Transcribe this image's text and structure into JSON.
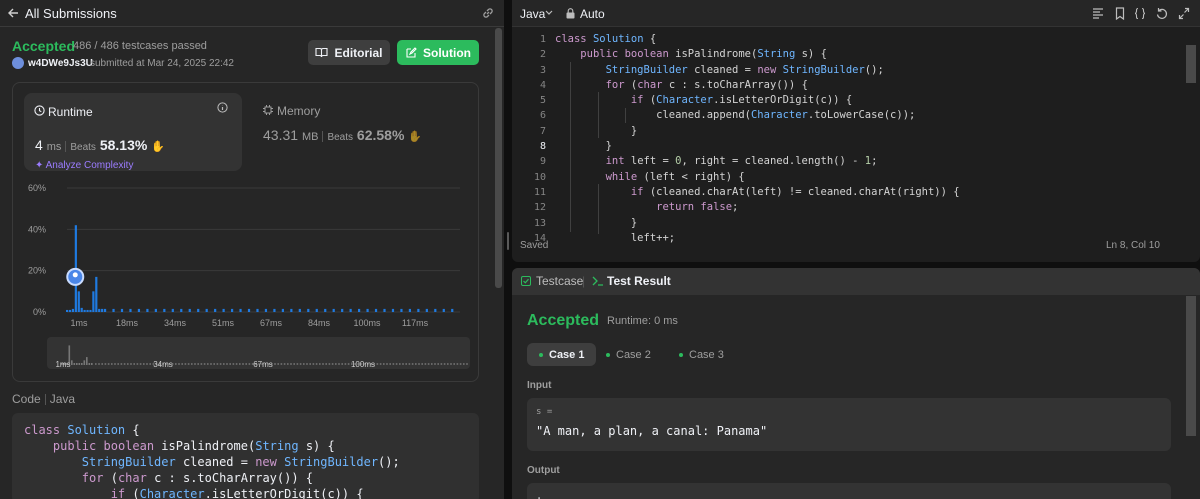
{
  "left_header": {
    "title": "All Submissions"
  },
  "submission": {
    "status": "Accepted",
    "testcases": "486 / 486 testcases passed",
    "username": "w4DWe9Js3U",
    "submitted_at": "submitted at Mar 24, 2025 22:42",
    "editorial_label": "Editorial",
    "solution_label": "Solution"
  },
  "runtime": {
    "label": "Runtime",
    "value": "4",
    "unit": "ms",
    "beats_label": "Beats",
    "beats_value": "58.13%",
    "analyze_label": "Analyze Complexity"
  },
  "memory": {
    "label": "Memory",
    "value": "43.31",
    "unit": "MB",
    "beats_label": "Beats",
    "beats_value": "62.58%"
  },
  "chart_data": {
    "type": "bar",
    "y_ticks": [
      "60%",
      "40%",
      "20%",
      "0%"
    ],
    "ylim": [
      0,
      60
    ],
    "x_ticks": [
      "1ms",
      "18ms",
      "34ms",
      "51ms",
      "67ms",
      "84ms",
      "100ms",
      "117ms"
    ],
    "bars": [
      {
        "x": 1,
        "y": 1
      },
      {
        "x": 2,
        "y": 1
      },
      {
        "x": 3,
        "y": 1.5
      },
      {
        "x": 4,
        "y": 42
      },
      {
        "x": 5,
        "y": 10
      },
      {
        "x": 6,
        "y": 2
      },
      {
        "x": 7,
        "y": 1
      },
      {
        "x": 8,
        "y": 1
      },
      {
        "x": 9,
        "y": 1
      },
      {
        "x": 10,
        "y": 10
      },
      {
        "x": 11,
        "y": 17
      },
      {
        "x": 12,
        "y": 1.5
      },
      {
        "x": 13,
        "y": 1.5
      }
    ],
    "small_bar_value": 1.5,
    "user_marker_x": 4,
    "mini_ticks": [
      "1ms",
      "34ms",
      "67ms",
      "100ms"
    ]
  },
  "code_section": {
    "label": "Code",
    "language": "Java"
  },
  "left_code_lines": [
    "class Solution {",
    "    public boolean isPalindrome(String s) {",
    "        StringBuilder cleaned = new StringBuilder();",
    "        for (char c : s.toCharArray()) {",
    "            if (Character.isLetterOrDigit(c)) {"
  ],
  "editor": {
    "language": "Java",
    "mode": "Auto",
    "status": "Saved",
    "cursor": "Ln 8, Col 10",
    "line_numbers": [
      "1",
      "2",
      "3",
      "4",
      "5",
      "6",
      "7",
      "8",
      "9",
      "10",
      "11",
      "12",
      "13",
      "14"
    ],
    "lines": [
      "class Solution {",
      "    public boolean isPalindrome(String s) {",
      "        StringBuilder cleaned = new StringBuilder();",
      "        for (char c : s.toCharArray()) {",
      "            if (Character.isLetterOrDigit(c)) {",
      "                cleaned.append(Character.toLowerCase(c));",
      "            }",
      "        }",
      "        int left = 0, right = cleaned.length() - 1;",
      "        while (left < right) {",
      "            if (cleaned.charAt(left) != cleaned.charAt(right)) {",
      "                return false;",
      "            }",
      "            left++;"
    ]
  },
  "bottom": {
    "tab_testcase": "Testcase",
    "tab_result": "Test Result",
    "result_status": "Accepted",
    "result_runtime": "Runtime: 0 ms",
    "cases": [
      "Case 1",
      "Case 2",
      "Case 3"
    ],
    "input_label": "Input",
    "input_var": "s =",
    "input_value": "\"A man, a plan, a canal: Panama\"",
    "output_label": "Output",
    "output_value": "true"
  },
  "colors": {
    "accent_green": "#2cbb5d",
    "bar_blue": "#1f7ae0",
    "purple": "#9b7cff"
  }
}
